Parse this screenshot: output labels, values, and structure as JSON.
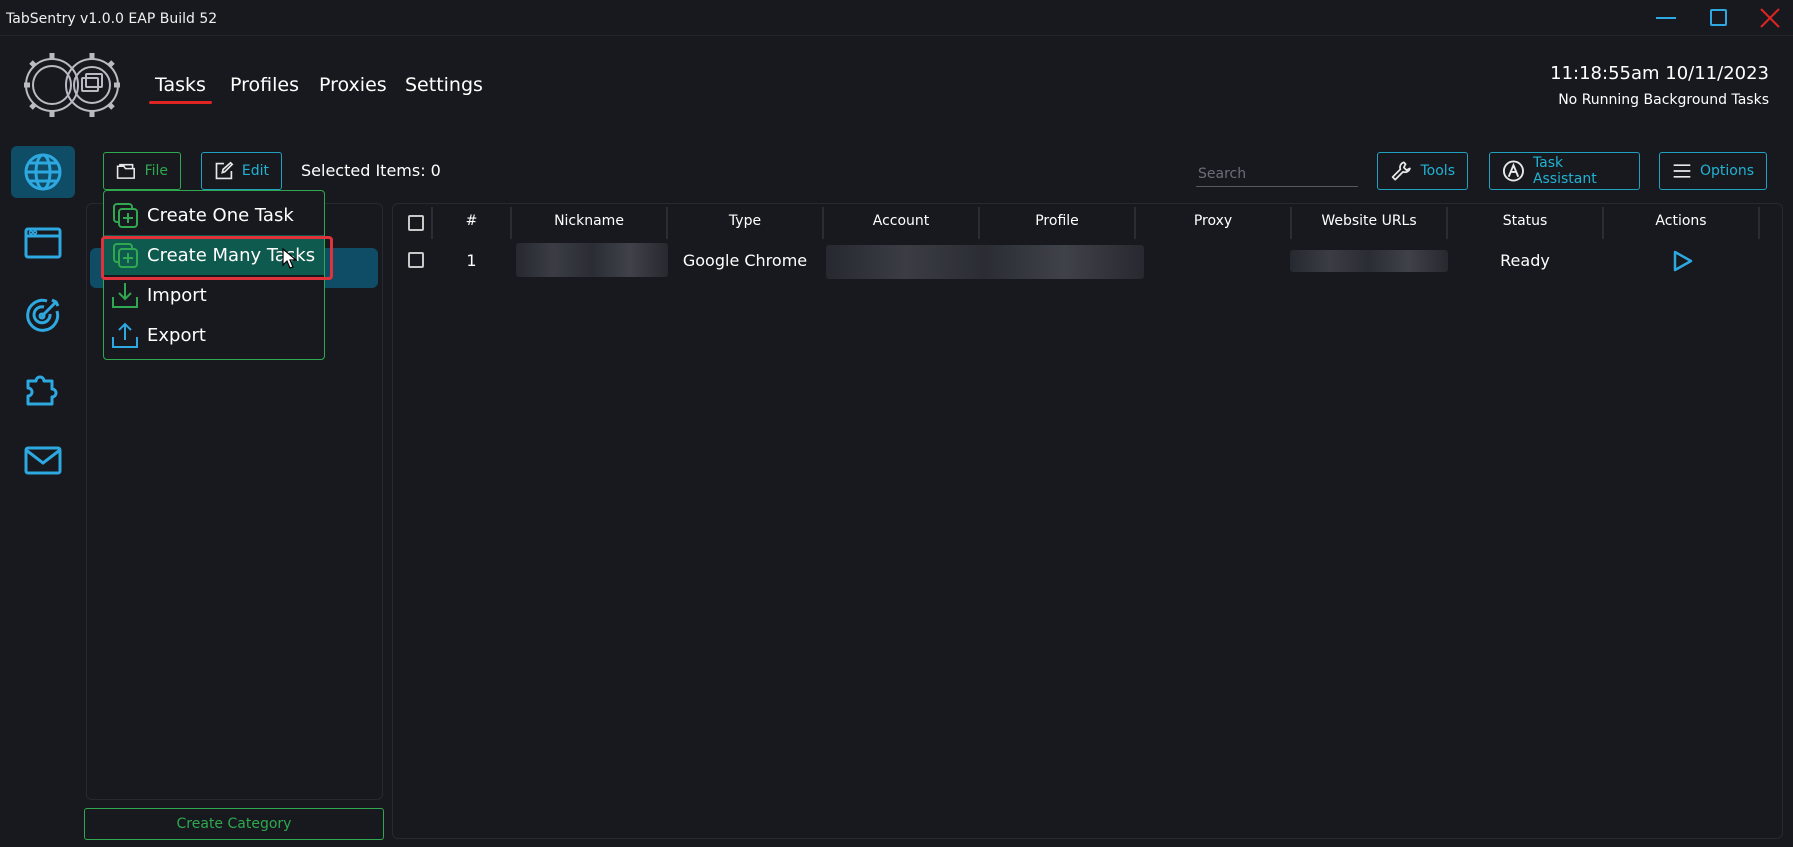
{
  "window": {
    "title": "TabSentry v1.0.0 EAP Build 52"
  },
  "nav": {
    "tabs": [
      "Tasks",
      "Profiles",
      "Proxies",
      "Settings"
    ],
    "active": "Tasks"
  },
  "header": {
    "clock": "11:18:55am 10/11/2023",
    "background_status": "No Running Background Tasks"
  },
  "sidebar": {
    "icons": [
      "globe-icon",
      "browser-window-icon",
      "target-icon",
      "puzzle-icon",
      "mail-icon"
    ],
    "active": "globe-icon"
  },
  "toolbar": {
    "file_label": "File",
    "edit_label": "Edit",
    "selected_items": "Selected Items: 0",
    "search_placeholder": "Search",
    "tools_label": "Tools",
    "assistant_label": "Task Assistant",
    "options_label": "Options"
  },
  "file_menu": {
    "items": [
      "Create One Task",
      "Create Many Tasks",
      "Import",
      "Export"
    ],
    "hovered": "Create Many Tasks"
  },
  "categories": {
    "create_label": "Create Category"
  },
  "table": {
    "headers": [
      "#",
      "Nickname",
      "Type",
      "Account",
      "Profile",
      "Proxy",
      "Website URLs",
      "Status",
      "Actions"
    ],
    "rows": [
      {
        "index": "1",
        "type": "Google Chrome",
        "status": "Ready",
        "action_icon": "play-icon"
      }
    ]
  },
  "colors": {
    "accent_green": "#2fa84f",
    "accent_teal": "#22b2d4",
    "active_blue": "#0f4c66",
    "active_tab_underline": "#e02424",
    "highlight_red": "#e0323a"
  }
}
